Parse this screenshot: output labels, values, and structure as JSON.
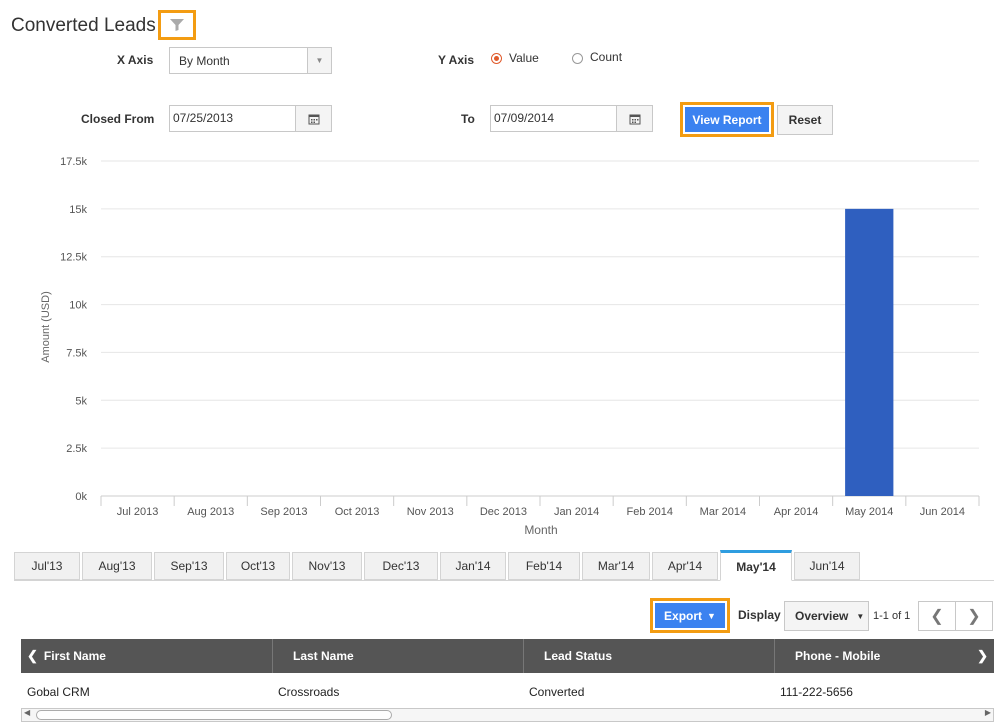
{
  "title": "Converted Leads",
  "filters": {
    "x_axis_label": "X Axis",
    "x_axis_value": "By Month",
    "y_axis_label": "Y Axis",
    "y_axis_options": [
      "Value",
      "Count"
    ],
    "y_axis_selected": "Value",
    "closed_from_label": "Closed From",
    "closed_from_value": "07/25/2013",
    "to_label": "To",
    "to_value": "07/09/2014",
    "view_report_label": "View Report",
    "reset_label": "Reset"
  },
  "chart_data": {
    "type": "bar",
    "xlabel": "Month",
    "ylabel": "Amount (USD)",
    "ylim": [
      0,
      17500
    ],
    "y_ticks": [
      "0k",
      "2.5k",
      "5k",
      "7.5k",
      "10k",
      "12.5k",
      "15k",
      "17.5k"
    ],
    "categories": [
      "Jul 2013",
      "Aug 2013",
      "Sep 2013",
      "Oct 2013",
      "Nov 2013",
      "Dec 2013",
      "Jan 2014",
      "Feb 2014",
      "Mar 2014",
      "Apr 2014",
      "May 2014",
      "Jun 2014"
    ],
    "values": [
      0,
      0,
      0,
      0,
      0,
      0,
      0,
      0,
      0,
      0,
      15000,
      0
    ],
    "bar_color": "#2f5fbf",
    "grid": true
  },
  "tabs": {
    "items": [
      "Jul'13",
      "Aug'13",
      "Sep'13",
      "Oct'13",
      "Nov'13",
      "Dec'13",
      "Jan'14",
      "Feb'14",
      "Mar'14",
      "Apr'14",
      "May'14",
      "Jun'14"
    ],
    "active": "May'14"
  },
  "toolbar": {
    "export_label": "Export",
    "display_label": "Display",
    "display_value": "Overview",
    "pagination_text": "1-1 of 1"
  },
  "table": {
    "columns": [
      "First Name",
      "Last Name",
      "Lead Status",
      "Phone - Mobile"
    ],
    "rows": [
      [
        "Gobal CRM",
        "Crossroads",
        "Converted",
        "111-222-5656"
      ]
    ]
  },
  "colors": {
    "accent_blue": "#3b82f0",
    "highlight_orange": "#f39c12",
    "tab_active_border": "#2f9de0",
    "header_bg": "#555555"
  }
}
